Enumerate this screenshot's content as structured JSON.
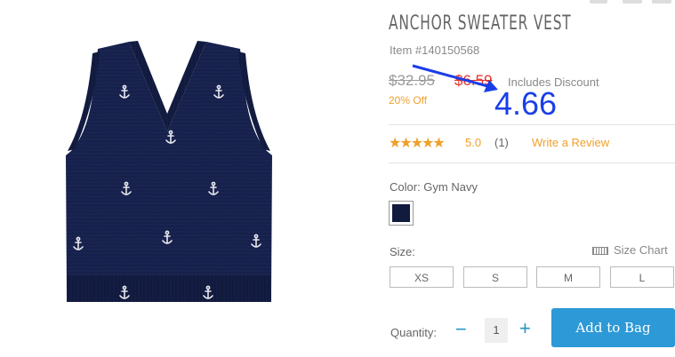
{
  "product": {
    "title": "ANCHOR SWEATER VEST",
    "item_number": "Item #140150568",
    "original_price": "$32.95",
    "sale_price": "$6.59",
    "includes_discount": "Includes Discount",
    "percent_off": "20% Off",
    "annotation_value": "4.66"
  },
  "rating": {
    "stars": "★★★★★",
    "score": "5.0",
    "count": "(1)",
    "write_review": "Write a Review",
    "value": 5
  },
  "color": {
    "label": "Color: Gym Navy",
    "swatch_hex": "#111b3d"
  },
  "size": {
    "label": "Size:",
    "chart_link": "Size Chart",
    "options": [
      "XS",
      "S",
      "M",
      "L"
    ]
  },
  "quantity": {
    "label": "Quantity:",
    "minus": "−",
    "value": "1",
    "plus": "+"
  },
  "cart": {
    "add_label": "Add to Bag"
  },
  "colors": {
    "accent_orange": "#f0a02a",
    "sale_red": "#e4322b",
    "button_blue": "#2d99d6",
    "annotation_blue": "#1a3ee8"
  }
}
